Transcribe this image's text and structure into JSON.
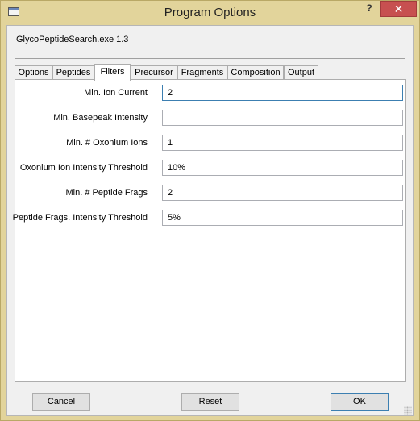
{
  "window": {
    "title": "Program Options",
    "help_glyph": "?",
    "close_glyph": "✕"
  },
  "app_label": "GlycoPeptideSearch.exe 1.3",
  "tabs": [
    {
      "label": "Options"
    },
    {
      "label": "Peptides"
    },
    {
      "label": "Filters",
      "active": true
    },
    {
      "label": "Precursor"
    },
    {
      "label": "Fragments"
    },
    {
      "label": "Composition"
    },
    {
      "label": "Output"
    }
  ],
  "filters": [
    {
      "label": "Min. Ion Current",
      "value": "2"
    },
    {
      "label": "Min. Basepeak Intensity",
      "value": ""
    },
    {
      "label": "Min. # Oxonium Ions",
      "value": "1"
    },
    {
      "label": "Oxonium Ion Intensity Threshold",
      "value": "10%"
    },
    {
      "label": "Min. # Peptide Frags",
      "value": "2"
    },
    {
      "label": "Peptide Frags. Intensity Threshold",
      "value": "5%"
    }
  ],
  "buttons": {
    "cancel": "Cancel",
    "reset": "Reset",
    "ok": "OK"
  }
}
